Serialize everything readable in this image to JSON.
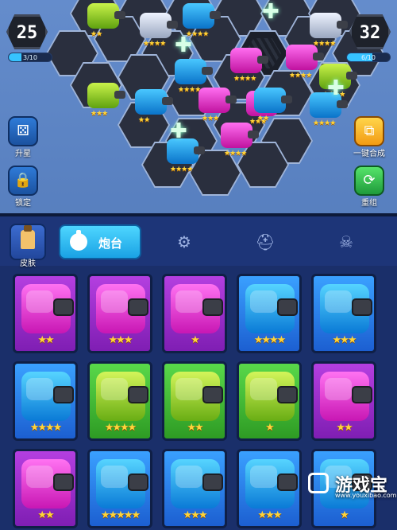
{
  "hud": {
    "left_score": "25",
    "left_progress_text": "3/10",
    "left_progress": 0.3,
    "right_score": "32",
    "right_progress_text": "6/10",
    "right_progress": 0.6
  },
  "side_buttons": {
    "upgrade_label": "升星",
    "lock_label": "锁定",
    "merge_label": "一键合成",
    "reset_label": "重组"
  },
  "tabs": {
    "skin_label": "皮肤",
    "turret_label": "炮台",
    "tab2_icon": "chip-icon",
    "tab3_icon": "helmet-icon",
    "tab4_icon": "monster-icon"
  },
  "colors": {
    "pink": "#c817b4",
    "blue": "#0a7ad6",
    "green": "#69ad14",
    "star": "#ffd43a"
  },
  "cards": [
    {
      "color": "pink",
      "stars": "★★"
    },
    {
      "color": "pink",
      "stars": "★★★"
    },
    {
      "color": "pink",
      "stars": "★"
    },
    {
      "color": "blue",
      "stars": "★★★★"
    },
    {
      "color": "blue",
      "stars": "★★★"
    },
    {
      "color": "blue",
      "stars": "★★★★"
    },
    {
      "color": "green",
      "stars": "★★★★"
    },
    {
      "color": "green",
      "stars": "★★"
    },
    {
      "color": "green",
      "stars": "★"
    },
    {
      "color": "pink",
      "stars": "★★"
    },
    {
      "color": "pink",
      "stars": "★★"
    },
    {
      "color": "blue",
      "stars": "★★★★★"
    },
    {
      "color": "blue",
      "stars": "★★★"
    },
    {
      "color": "blue",
      "stars": "★★★"
    },
    {
      "color": "blue",
      "stars": "★"
    }
  ],
  "board_units": [
    {
      "color": "green",
      "stars": "★★"
    },
    {
      "color": "white",
      "stars": "★★★★"
    },
    {
      "color": "blue",
      "stars": "★★★★"
    },
    {
      "color": "white",
      "stars": "★★★★"
    },
    {
      "color": "green",
      "stars": "★★★★"
    },
    {
      "color": "blue",
      "stars": "★★★★"
    },
    {
      "color": "pink",
      "stars": "★★★★"
    },
    {
      "color": "pink",
      "stars": "★★★★"
    },
    {
      "color": "green",
      "stars": "★★★"
    },
    {
      "color": "pink",
      "stars": "★★★"
    },
    {
      "color": "blue",
      "stars": "★★"
    },
    {
      "color": "pink",
      "stars": "★★★"
    },
    {
      "color": "blue",
      "stars": "★★"
    },
    {
      "color": "blue",
      "stars": "★★★★"
    },
    {
      "color": "blue",
      "stars": "★★★★"
    },
    {
      "color": "pink",
      "stars": "★★★★"
    }
  ],
  "watermark": {
    "text": "游戏宝",
    "url": "www.youxibao.com"
  }
}
